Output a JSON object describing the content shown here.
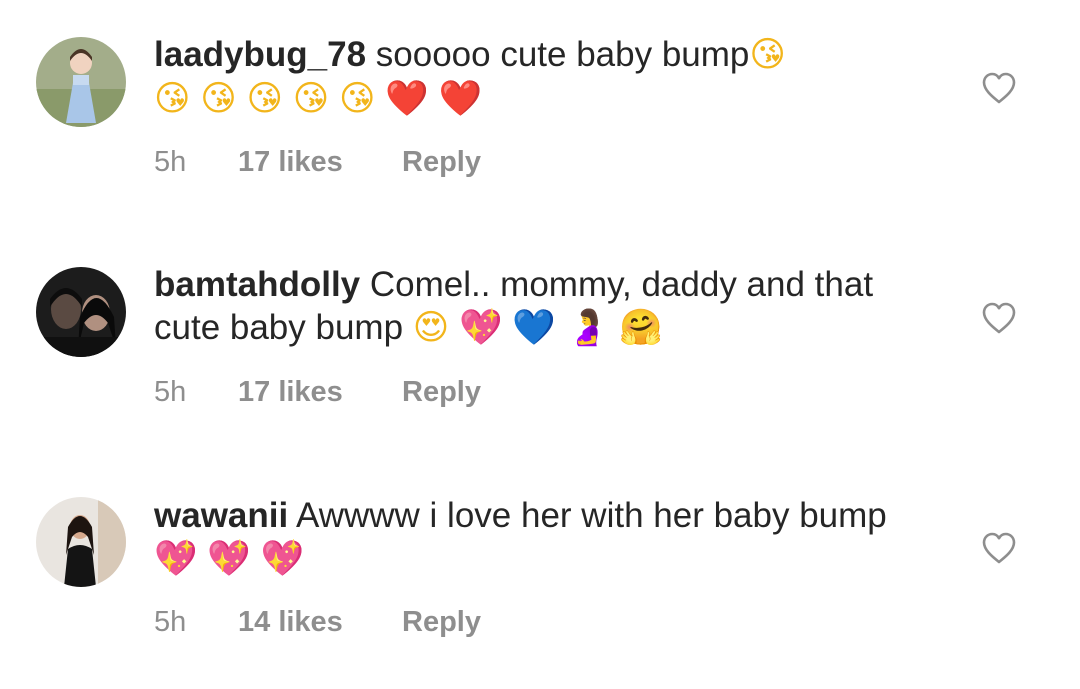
{
  "comments": [
    {
      "username": "laadybug_78",
      "text": "sooooo cute baby bump",
      "emojis": [
        {
          "char": "😘",
          "color": "#f2b51b"
        },
        {
          "char": "😘",
          "color": "#f2b51b"
        },
        {
          "char": "😘",
          "color": "#f2b51b"
        },
        {
          "char": "😘",
          "color": "#f2b51b"
        },
        {
          "char": "😘",
          "color": "#f2b51b"
        },
        {
          "char": "😘",
          "color": "#f2b51b"
        },
        {
          "char": "❤️",
          "color": "#e3151e"
        },
        {
          "char": "❤️",
          "color": "#e3151e"
        }
      ],
      "time": "5h",
      "likes": "17 likes",
      "reply": "Reply"
    },
    {
      "username": "bamtahdolly",
      "text": "Comel.. mommy, daddy and that cute baby bump",
      "emojis": [
        {
          "char": "😍",
          "color": "#f2b51b"
        },
        {
          "char": "💖",
          "color": "#ee4a90"
        },
        {
          "char": "💙",
          "color": "#2c7ee6"
        },
        {
          "char": "🤰",
          "color": "#8e4bb3"
        },
        {
          "char": "🤗",
          "color": "#f2b51b"
        }
      ],
      "time": "5h",
      "likes": "17 likes",
      "reply": "Reply"
    },
    {
      "username": "wawanii",
      "text": "Awwww i love her with her baby bump",
      "emojis": [
        {
          "char": "💖",
          "color": "#ee4a90"
        },
        {
          "char": "💖",
          "color": "#ee4a90"
        },
        {
          "char": "💖",
          "color": "#ee4a90"
        }
      ],
      "time": "5h",
      "likes": "14 likes",
      "reply": "Reply"
    }
  ],
  "icons": {
    "like": "heart-outline-icon"
  },
  "colors": {
    "text": "#262626",
    "meta": "#8e8e8e",
    "background": "#ffffff"
  }
}
